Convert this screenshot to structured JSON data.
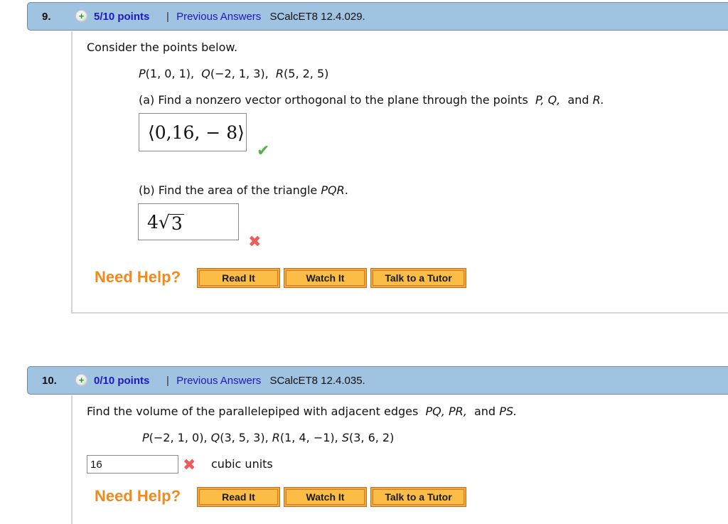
{
  "questions": [
    {
      "number": "9.",
      "points": "5/10 points",
      "separator": "|",
      "previous_answers_label": "Previous Answers",
      "code": "SCalcET8 12.4.029.",
      "prompt": "Consider the points below.",
      "points_list": {
        "P": "P",
        "P_coords": "(1, 0, 1),",
        "Q": "Q",
        "Q_coords": "(−2, 1, 3),",
        "R": "R",
        "R_coords": "(5, 2, 5)"
      },
      "part_a": {
        "text": "(a) Find a nonzero vector orthogonal to the plane through the points",
        "vars": [
          "P,",
          "Q,",
          "and",
          "R."
        ],
        "answer": "⟨0,16, − 8⟩",
        "status": "correct",
        "status_icon": "check-icon"
      },
      "part_b": {
        "text": "(b) Find the area of the triangle",
        "var": "PQR",
        "period": ".",
        "answer_coef": "4",
        "answer_rad": "√",
        "answer_under": "3",
        "status": "incorrect",
        "status_icon": "cross-icon"
      },
      "help": {
        "label": "Need Help?",
        "buttons": [
          "Read It",
          "Watch It",
          "Talk to a Tutor"
        ]
      }
    },
    {
      "number": "10.",
      "points": "0/10 points",
      "separator": "|",
      "previous_answers_label": "Previous Answers",
      "code": "SCalcET8 12.4.035.",
      "prompt_start": "Find the volume of the parallelepiped with adjacent edges",
      "prompt_vars": [
        "PQ,",
        "PR,",
        "and",
        "PS."
      ],
      "points_list": {
        "P": "P",
        "P_coords": "(−2, 1, 0),",
        "Q": "Q",
        "Q_coords": "(3, 5, 3),",
        "R": "R",
        "R_coords": "(1, 4, −1),",
        "S": "S",
        "S_coords": "(3, 6, 2)"
      },
      "answer_value": "16",
      "status": "incorrect",
      "status_icon": "cross-icon",
      "units": "cubic units",
      "help": {
        "label": "Need Help?",
        "buttons": [
          "Read It",
          "Watch It",
          "Talk to a Tutor"
        ]
      }
    }
  ],
  "colors": {
    "header_bg": "#9fc3e0",
    "link": "#1b1bbf",
    "correct": "#54b04a",
    "incorrect": "#f05a5a",
    "help_orange": "#f08a1c",
    "button_fill": "#fbbd45"
  }
}
